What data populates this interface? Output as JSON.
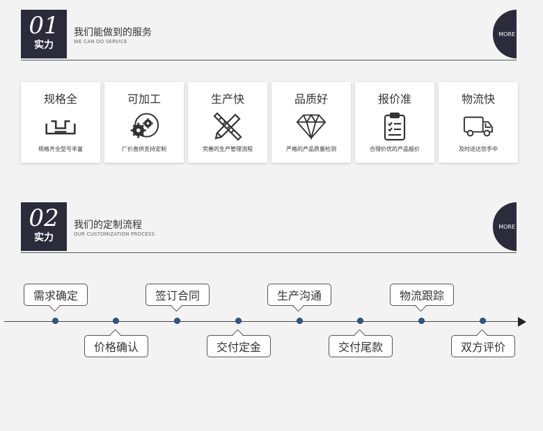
{
  "section1": {
    "number": "01",
    "badge_sub": "实力",
    "title": "我们能做到的服务",
    "subtitle": "WE CAN DO SERVICE",
    "more": "MORE"
  },
  "cards": [
    {
      "title": "规格全",
      "desc": "规格齐全型号丰富",
      "icon": "specs-bracket-icon"
    },
    {
      "title": "可加工",
      "desc": "厂价直供支持定制",
      "icon": "gears-icon"
    },
    {
      "title": "生产快",
      "desc": "完善的生产管理流程",
      "icon": "ruler-pencil-icon"
    },
    {
      "title": "品质好",
      "desc": "严格的产品质量检测",
      "icon": "diamond-icon"
    },
    {
      "title": "报价准",
      "desc": "合理价优的产品报价",
      "icon": "clipboard-icon"
    },
    {
      "title": "物流快",
      "desc": "及时送达您手中",
      "icon": "truck-icon"
    }
  ],
  "section2": {
    "number": "02",
    "badge_sub": "实力",
    "title": "我们的定制流程",
    "subtitle": "OUR CUSTOMIZATION PROCESS",
    "more": "MORE"
  },
  "process": {
    "steps": [
      "需求确定",
      "价格确认",
      "签订合同",
      "交付定金",
      "生产沟通",
      "交付尾款",
      "物流跟踪",
      "双方评价"
    ]
  },
  "colors": {
    "dark": "#2b2b3b",
    "node": "#2e5a8a",
    "background": "#f3f3f3"
  }
}
